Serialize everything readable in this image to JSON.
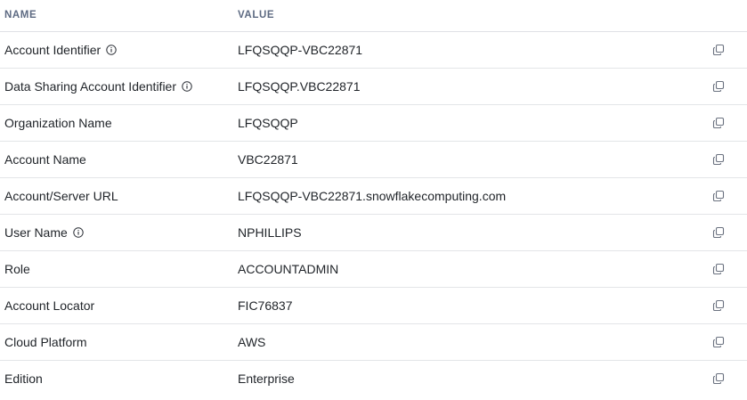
{
  "header": {
    "name_label": "NAME",
    "value_label": "VALUE"
  },
  "rows": [
    {
      "name": "Account Identifier",
      "value": "LFQSQQP-VBC22871",
      "info": true
    },
    {
      "name": "Data Sharing Account Identifier",
      "value": "LFQSQQP.VBC22871",
      "info": true
    },
    {
      "name": "Organization Name",
      "value": "LFQSQQP",
      "info": false
    },
    {
      "name": "Account Name",
      "value": "VBC22871",
      "info": false
    },
    {
      "name": "Account/Server URL",
      "value": "LFQSQQP-VBC22871.snowflakecomputing.com",
      "info": false
    },
    {
      "name": "User Name",
      "value": "NPHILLIPS",
      "info": true
    },
    {
      "name": "Role",
      "value": "ACCOUNTADMIN",
      "info": false
    },
    {
      "name": "Account Locator",
      "value": "FIC76837",
      "info": false
    },
    {
      "name": "Cloud Platform",
      "value": "AWS",
      "info": false
    },
    {
      "name": "Edition",
      "value": "Enterprise",
      "info": false
    }
  ],
  "icons": {
    "info": "info-circle-icon",
    "copy": "copy-icon"
  },
  "colors": {
    "header_text": "#5d6a82",
    "row_border": "#e3e5e8",
    "icon": "#6b7280"
  }
}
